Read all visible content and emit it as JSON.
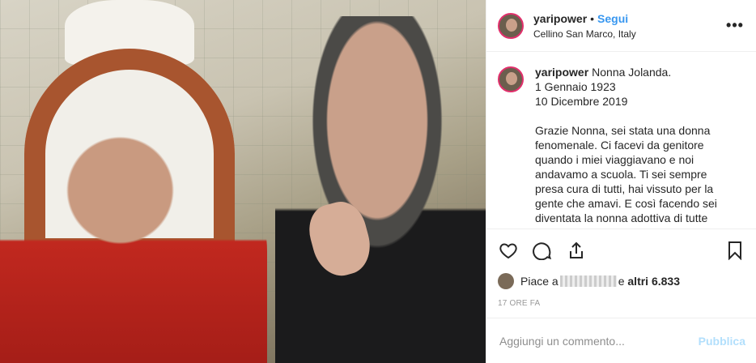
{
  "header": {
    "username": "yaripower",
    "dot": "•",
    "follow_label": "Segui",
    "location": "Cellino San Marco, Italy",
    "more_label": "•••"
  },
  "caption": {
    "username": "yaripower",
    "text": "Nonna Jolanda.\n1 Gennaio 1923\n10 Dicembre 2019\n\nGrazie Nonna, sei stata una donna fenomenale. Ci facevi da genitore quando i miei viaggiavano e noi andavamo a scuola. Ti sei sempre presa cura di tutti, hai vissuto per la gente che amavi. E così facendo sei diventata la nonna adottiva di tutte"
  },
  "actions": {
    "icons": [
      "heart-icon",
      "comment-icon",
      "share-icon",
      "bookmark-icon"
    ]
  },
  "likes": {
    "prefix": "Piace a",
    "joiner": "e",
    "others_label": "altri 6.833"
  },
  "time": "17 ORE FA",
  "comment_box": {
    "placeholder": "Aggiungi un commento...",
    "publish_label": "Pubblica"
  },
  "colors": {
    "accent_blue": "#3897f0",
    "publish_disabled": "#b2dffc",
    "text": "#262626",
    "muted": "#999999"
  }
}
